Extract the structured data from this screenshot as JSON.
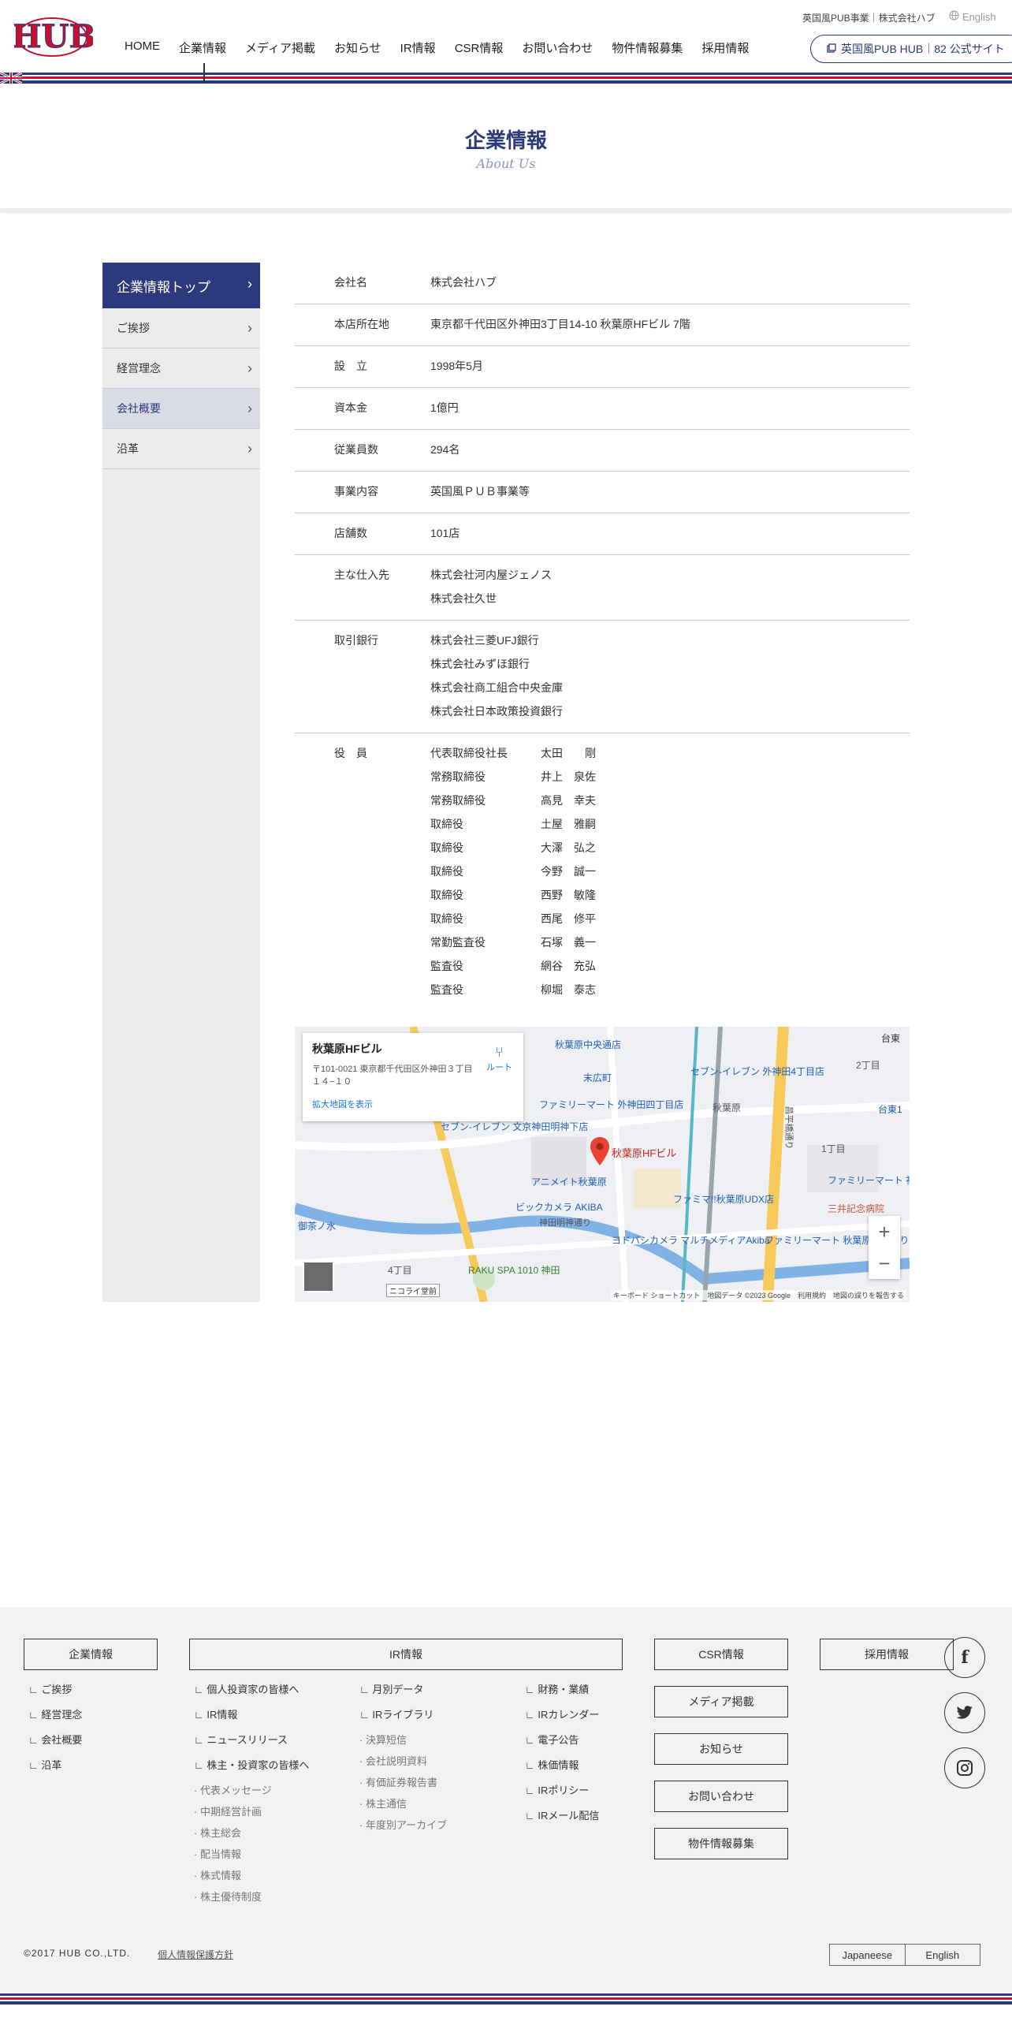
{
  "header": {
    "logo_text": "HUB",
    "top_text": "英国風PUB事業｜株式会社ハブ",
    "lang_label": "English",
    "nav": [
      "HOME",
      "企業情報",
      "メディア掲載",
      "お知らせ",
      "IR情報",
      "CSR情報",
      "お問い合わせ",
      "物件情報募集",
      "採用情報"
    ],
    "pub_button": "英国風PUB HUB｜82 公式サイト"
  },
  "banner": {
    "title": "企業情報",
    "subtitle": "About Us"
  },
  "sidebar": {
    "items": [
      {
        "label": "企業情報トップ"
      },
      {
        "label": "ご挨拶"
      },
      {
        "label": "経営理念"
      },
      {
        "label": "会社概要"
      },
      {
        "label": "沿革"
      }
    ]
  },
  "company": {
    "rows": [
      {
        "k": "会社名",
        "v": [
          "株式会社ハブ"
        ]
      },
      {
        "k": "本店所在地",
        "v": [
          "東京都千代田区外神田3丁目14-10 秋葉原HFビル 7階"
        ]
      },
      {
        "k": "設　立",
        "v": [
          "1998年5月"
        ]
      },
      {
        "k": "資本金",
        "v": [
          "1億円"
        ]
      },
      {
        "k": "従業員数",
        "v": [
          "294名"
        ]
      },
      {
        "k": "事業内容",
        "v": [
          "英国風ＰＵＢ事業等"
        ]
      },
      {
        "k": "店舗数",
        "v": [
          "101店"
        ]
      },
      {
        "k": "主な仕入先",
        "v": [
          "株式会社河内屋ジェノス",
          "株式会社久世"
        ]
      },
      {
        "k": "取引銀行",
        "v": [
          "株式会社三菱UFJ銀行",
          "株式会社みずほ銀行",
          "株式会社商工組合中央金庫",
          "株式会社日本政策投資銀行"
        ]
      }
    ],
    "officers_label": "役　員",
    "officers": [
      {
        "t": "代表取締役社長",
        "n": "太田　　剛"
      },
      {
        "t": "常務取締役",
        "n": "井上　泉佐"
      },
      {
        "t": "常務取締役",
        "n": "高見　幸夫"
      },
      {
        "t": "取締役",
        "n": "土屋　雅嗣"
      },
      {
        "t": "取締役",
        "n": "大澤　弘之"
      },
      {
        "t": "取締役",
        "n": "今野　誠一"
      },
      {
        "t": "取締役",
        "n": "西野　敏隆"
      },
      {
        "t": "取締役",
        "n": "西尾　修平"
      },
      {
        "t": "常勤監査役",
        "n": "石塚　義一"
      },
      {
        "t": "監査役",
        "n": "網谷　充弘"
      },
      {
        "t": "監査役",
        "n": "柳堀　泰志"
      }
    ]
  },
  "map": {
    "place_name": "秋葉原HFビル",
    "address": "〒101-0021 東京都千代田区外神田３丁目１４−１０",
    "enlarge_link": "拡大地図を表示",
    "route_label": "ルート",
    "pin_label": "秋葉原HFビル",
    "labels": [
      "秋葉原中央通店",
      "末広町",
      "セブン-イレブン 外神田4丁目店",
      "ファミリーマート 外神田四丁目店",
      "セブン-イレブン 文京神田明神下店",
      "アニメイト秋葉原",
      "ビックカメラ AKIBA",
      "ファミマ!!秋葉原UDX店",
      "ヨドバシカメラ マルチメディアAkiba",
      "秋葉原",
      "三井記念病院",
      "ファミリーマート 神田和泉町店",
      "ファミリーマート 秋葉原昭和通り店",
      "御茶ノ水",
      "RAKU SPA 1010 神田",
      "台東1",
      "台東",
      "1丁目",
      "2丁目",
      "4丁目",
      "神田明神通り",
      "昌平橋通り",
      "ニコライ堂前"
    ],
    "zoom_in": "+",
    "zoom_out": "−",
    "attribution": "キーボード ショートカット　地図データ ©2023 Google　利用規約　地図の誤りを報告する"
  },
  "footer": {
    "col1": {
      "title": "企業情報",
      "links": [
        "ご挨拶",
        "経営理念",
        "会社概要",
        "沿革"
      ]
    },
    "col2": {
      "title": "IR情報",
      "links_a": [
        "個人投資家の皆様へ",
        "IR情報",
        "ニュースリリース",
        "株主・投資家の皆様へ"
      ],
      "subs_a": [
        "代表メッセージ",
        "中期経営計画",
        "株主総会",
        "配当情報",
        "株式情報",
        "株主優待制度"
      ],
      "links_b": [
        "月別データ",
        "IRライブラリ"
      ],
      "subs_b": [
        "決算短信",
        "会社説明資料",
        "有価証券報告書",
        "株主通信",
        "年度別アーカイブ"
      ],
      "links_c": [
        "財務・業績",
        "IRカレンダー",
        "電子公告",
        "株価情報",
        "IRポリシー",
        "IRメール配信"
      ]
    },
    "boxes": [
      "CSR情報",
      "メディア掲載",
      "お知らせ",
      "お問い合わせ",
      "物件情報募集"
    ],
    "recruit": "採用情報",
    "copyright": "©2017 HUB CO.,LTD.",
    "privacy": "個人情報保護方針",
    "lang": [
      "Japaneese",
      "English"
    ]
  }
}
